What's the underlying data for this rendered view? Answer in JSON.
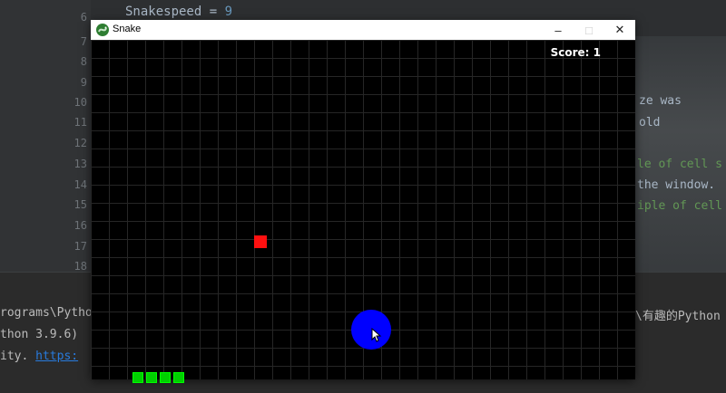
{
  "editor": {
    "line_numbers": [
      "6",
      "7",
      "8",
      "9",
      "10",
      "11",
      "12",
      "13",
      "14",
      "15",
      "16",
      "17",
      "18"
    ],
    "code_top": {
      "name": "Snakespeed",
      "op": " = ",
      "value": "9"
    },
    "fragments": [
      {
        "text": "ze was",
        "comment": false
      },
      {
        "text": "old",
        "comment": false
      },
      {
        "text": "le of cell s",
        "comment": true
      },
      {
        "text": "the window.",
        "comment": false
      },
      {
        "text": "iple of cell",
        "comment": true
      }
    ]
  },
  "terminal": {
    "line1_left": "rograms\\Pytho",
    "line1_right": "\\有趣的Python",
    "line2": "thon 3.9.6)",
    "line3_prefix": "ity. ",
    "line3_link": "https:"
  },
  "window": {
    "title": "Snake",
    "buttons": {
      "minimize": "–",
      "maximize": "□",
      "close": "✕"
    }
  },
  "game": {
    "score_text": "Score: 1",
    "snake_length": 4,
    "colors": {
      "background": "#000000",
      "grid": "#262626",
      "snake": "#00d000",
      "food": "#ff1010",
      "ball": "#0000ff"
    },
    "icons": [
      "snake-app-icon",
      "mouse-pointer-icon"
    ]
  }
}
